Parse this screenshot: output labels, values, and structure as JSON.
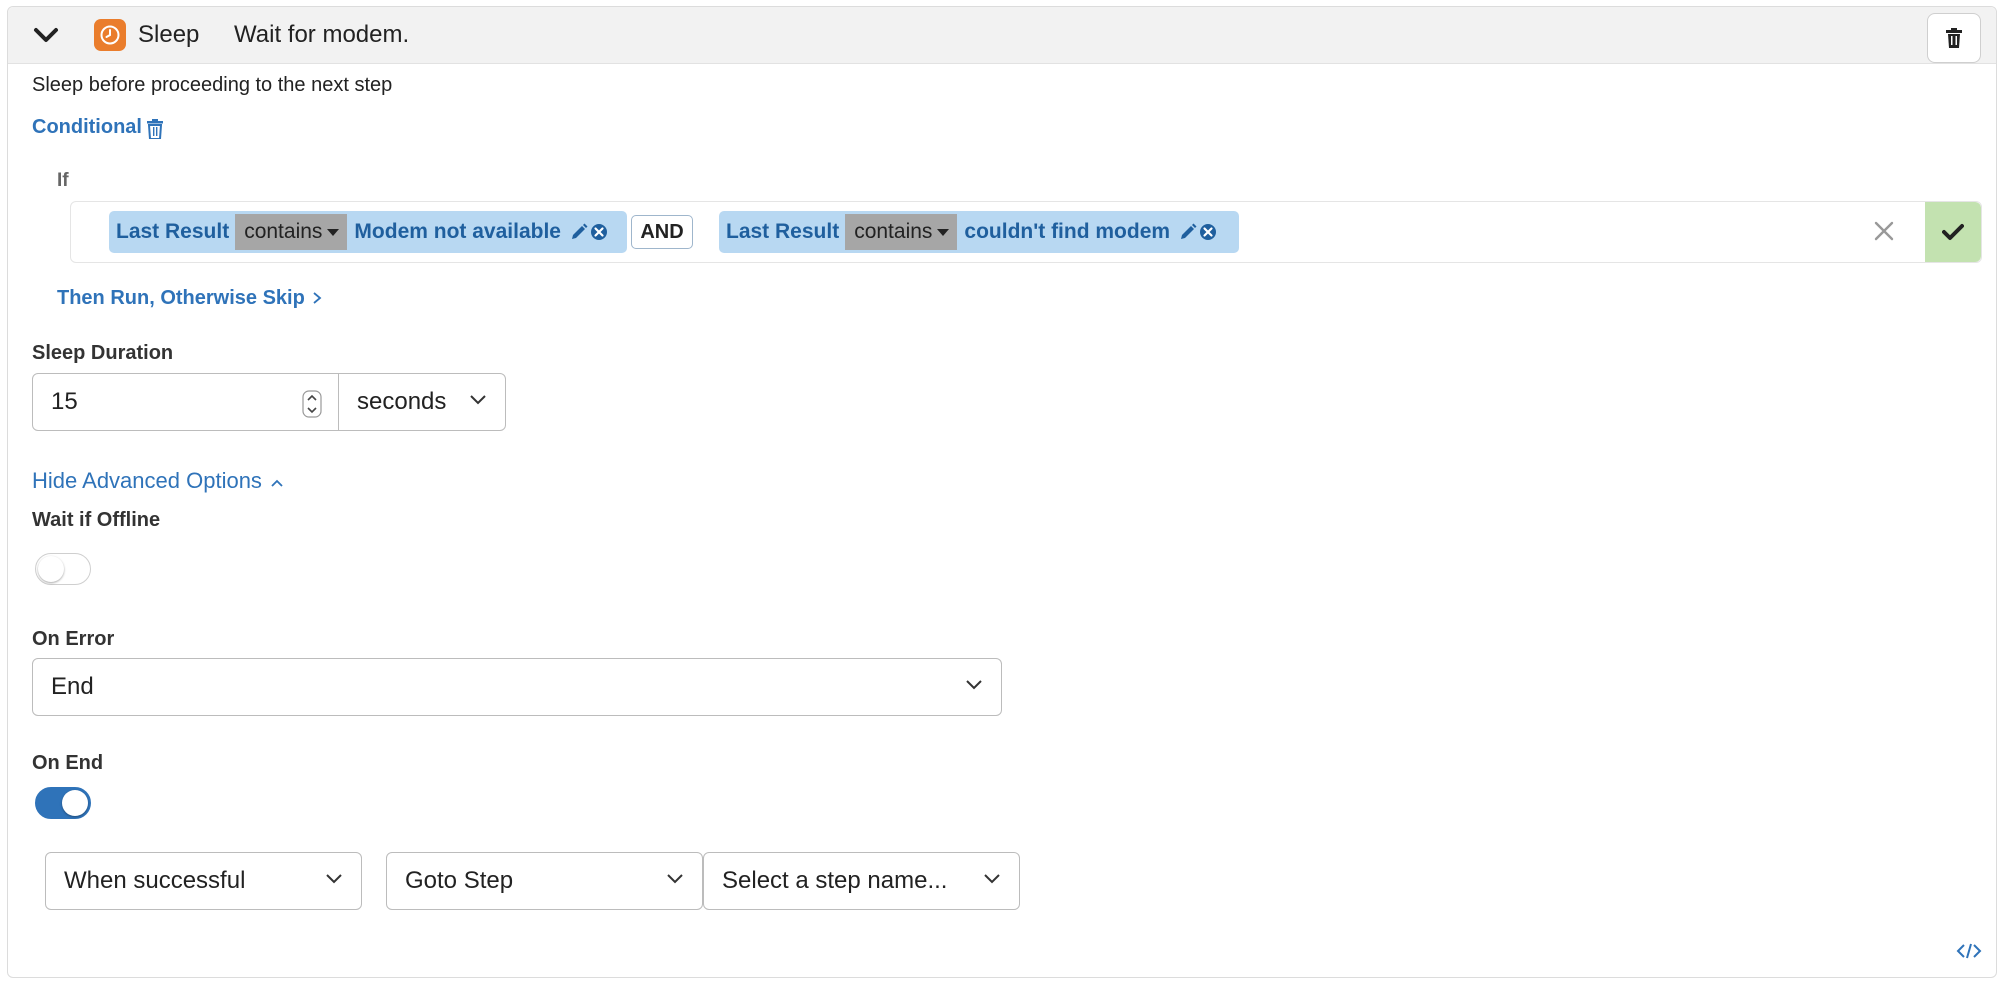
{
  "header": {
    "step_type": "Sleep",
    "step_name": "Wait for modem.",
    "icons": {
      "collapse": "chevron-down-icon",
      "type": "clock-icon",
      "delete": "trash-icon"
    },
    "accent_color": "#ea7d2c"
  },
  "description": "Sleep before proceeding to the next step",
  "conditional": {
    "label": "Conditional",
    "if_label": "If",
    "conditions": [
      {
        "field": "Last Result",
        "operator": "contains",
        "value": "Modem not available"
      },
      {
        "field": "Last Result",
        "operator": "contains",
        "value": "couldn't find modem"
      }
    ],
    "joiner": "AND",
    "then_label": "Then Run, Otherwise Skip",
    "chip_color": "#b8d8f2",
    "apply_color": "#c3e2b0"
  },
  "sleep_duration": {
    "label": "Sleep Duration",
    "value": "15",
    "unit": "seconds"
  },
  "advanced": {
    "toggle_label": "Hide Advanced Options",
    "wait_if_offline": {
      "label": "Wait if Offline",
      "enabled": false
    },
    "on_error": {
      "label": "On Error",
      "value": "End"
    },
    "on_end": {
      "label": "On End",
      "enabled": true,
      "when": "When successful",
      "action": "Goto Step",
      "target_placeholder": "Select a step name..."
    }
  },
  "link_color": "#2f73b9"
}
